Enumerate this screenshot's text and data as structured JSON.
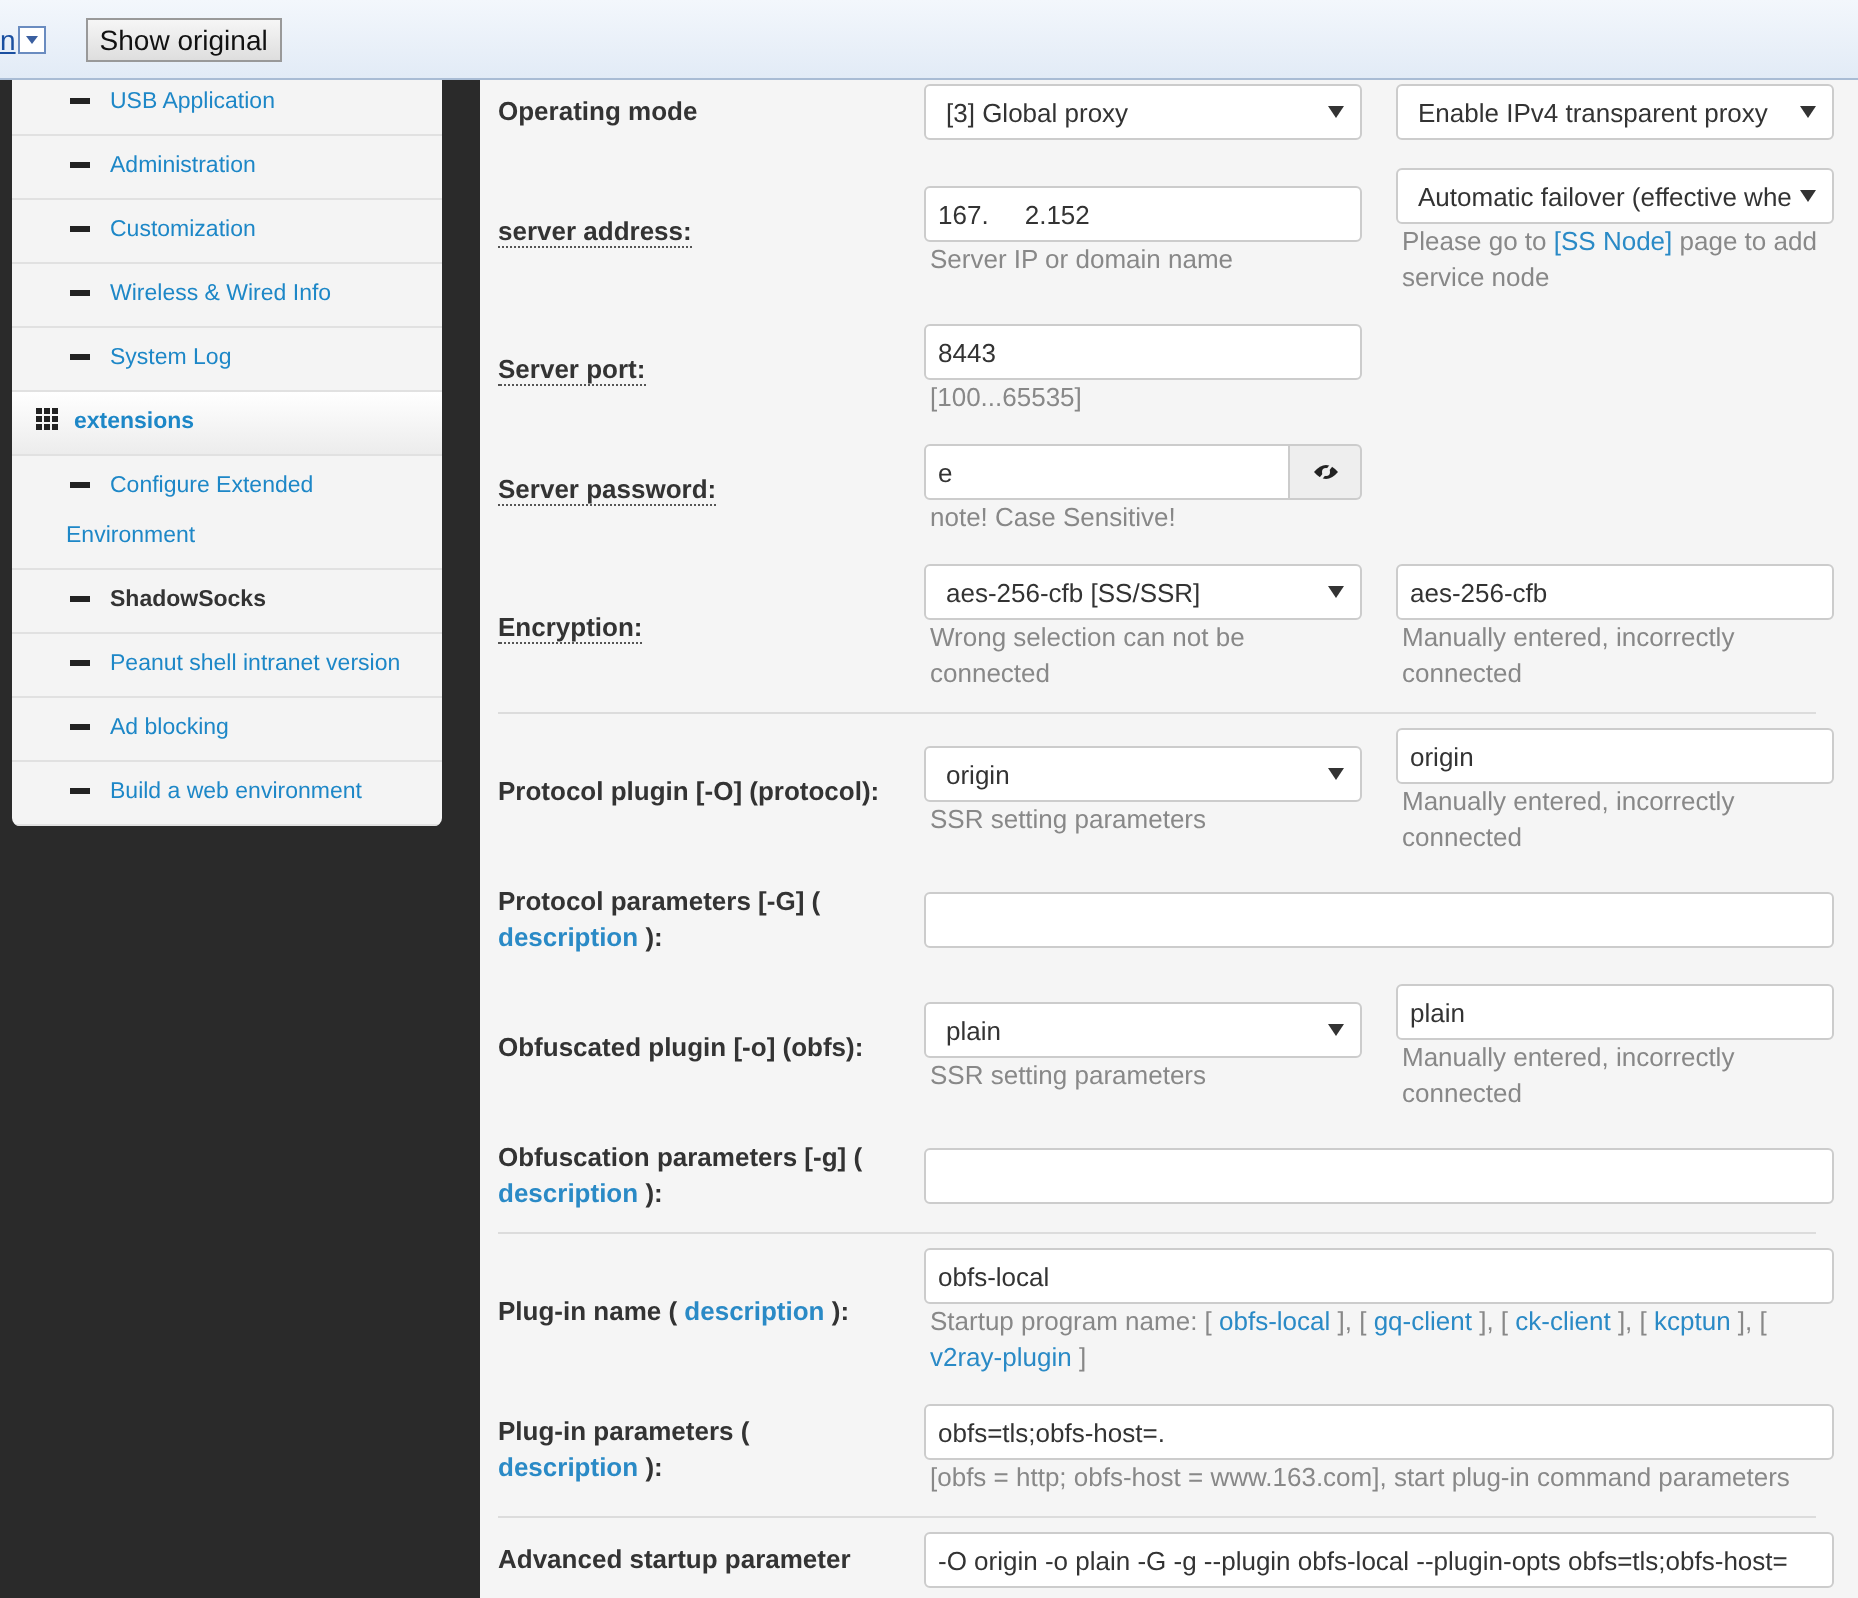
{
  "top_bar": {
    "language_fragment": "n",
    "show_original_button": "Show original"
  },
  "sidebar": {
    "items": [
      {
        "label": "USB Application",
        "kind": "sub",
        "selected": false
      },
      {
        "label": "Administration",
        "kind": "sub",
        "selected": false
      },
      {
        "label": "Customization",
        "kind": "sub",
        "selected": false
      },
      {
        "label": "Wireless & Wired Info",
        "kind": "sub",
        "selected": false
      },
      {
        "label": "System Log",
        "kind": "sub",
        "selected": false
      },
      {
        "label": "extensions",
        "kind": "group",
        "selected": false
      },
      {
        "label": "Configure Extended Environment",
        "kind": "sub",
        "selected": false
      },
      {
        "label": "ShadowSocks",
        "kind": "sub",
        "selected": true
      },
      {
        "label": "Peanut shell intranet version",
        "kind": "sub",
        "selected": false
      },
      {
        "label": "Ad blocking",
        "kind": "sub",
        "selected": false
      },
      {
        "label": "Build a web environment",
        "kind": "sub",
        "selected": false
      }
    ]
  },
  "sections": [
    {
      "rows": [
        {
          "label": [
            {
              "text": "Operating mode",
              "link": false
            }
          ],
          "underlined": false,
          "fields": [
            {
              "kind": "select",
              "value": "[3] Global proxy"
            },
            {
              "kind": "select",
              "value": "Enable IPv4 transparent proxy"
            }
          ]
        },
        {
          "label": [
            {
              "text": "server address:",
              "link": false
            }
          ],
          "underlined": true,
          "fields": [
            {
              "kind": "input",
              "value": "167.     2.152",
              "note": [
                {
                  "text": "Server IP or domain name",
                  "link": false
                }
              ]
            },
            {
              "kind": "select",
              "value": "Automatic failover (effective whe",
              "note": [
                {
                  "text": "Please go to ",
                  "link": false
                },
                {
                  "text": "[SS Node]",
                  "link": true
                },
                {
                  "text": " page to add service node",
                  "link": false
                }
              ]
            }
          ]
        },
        {
          "label": [
            {
              "text": "Server port:",
              "link": false
            }
          ],
          "underlined": true,
          "fields": [
            {
              "kind": "input",
              "value": "8443",
              "note": [
                {
                  "text": "[100...65535]",
                  "link": false
                }
              ]
            }
          ]
        },
        {
          "label": [
            {
              "text": "Server password:",
              "link": false
            }
          ],
          "underlined": true,
          "fields": [
            {
              "kind": "password",
              "value": "e",
              "note": [
                {
                  "text": "note! Case Sensitive!",
                  "link": false
                }
              ]
            }
          ]
        },
        {
          "label": [
            {
              "text": "Encryption:",
              "link": false
            }
          ],
          "underlined": true,
          "fields": [
            {
              "kind": "select",
              "value": "aes-256-cfb [SS/SSR]",
              "note": [
                {
                  "text": "Wrong selection can not be connected",
                  "link": false
                }
              ]
            },
            {
              "kind": "input",
              "value": "aes-256-cfb",
              "note": [
                {
                  "text": "Manually entered, incorrectly connected",
                  "link": false
                }
              ]
            }
          ]
        }
      ]
    },
    {
      "rows": [
        {
          "label": [
            {
              "text": "Protocol plugin [-O] (protocol):",
              "link": false
            }
          ],
          "underlined": false,
          "fields": [
            {
              "kind": "select",
              "value": "origin",
              "note": [
                {
                  "text": "SSR setting parameters",
                  "link": false
                }
              ]
            },
            {
              "kind": "input",
              "value": "origin",
              "note": [
                {
                  "text": "Manually entered, incorrectly connected",
                  "link": false
                }
              ]
            }
          ]
        },
        {
          "label": [
            {
              "text": "Protocol parameters [-G] ( ",
              "link": false
            },
            {
              "text": "description",
              "link": true
            },
            {
              "text": " ):",
              "link": false
            }
          ],
          "underlined": false,
          "fields": [
            {
              "kind": "wide_input"
            }
          ]
        },
        {
          "label": [
            {
              "text": "Obfuscated plugin [-o] (obfs):",
              "link": false
            }
          ],
          "underlined": false,
          "fields": [
            {
              "kind": "select",
              "value": "plain",
              "note": [
                {
                  "text": "SSR setting parameters",
                  "link": false
                }
              ]
            },
            {
              "kind": "input",
              "value": "plain",
              "note": [
                {
                  "text": "Manually entered, incorrectly connected",
                  "link": false
                }
              ]
            }
          ]
        },
        {
          "label": [
            {
              "text": "Obfuscation parameters [-g] ( ",
              "link": false
            },
            {
              "text": "description",
              "link": true
            },
            {
              "text": " ):",
              "link": false
            }
          ],
          "underlined": false,
          "fields": [
            {
              "kind": "wide_input"
            }
          ]
        }
      ]
    },
    {
      "rows": [
        {
          "label": [
            {
              "text": "Plug-in name ( ",
              "link": false
            },
            {
              "text": "description",
              "link": true
            },
            {
              "text": " ):",
              "link": false
            }
          ],
          "underlined": false,
          "fields": [
            {
              "kind": "wide_input",
              "value": "obfs-local",
              "note": [
                {
                  "text": "Startup program name: [ ",
                  "link": false
                },
                {
                  "text": "obfs-local",
                  "link": true
                },
                {
                  "text": " ], [ ",
                  "link": false
                },
                {
                  "text": "gq-client",
                  "link": true
                },
                {
                  "text": " ], [ ",
                  "link": false
                },
                {
                  "text": "ck-client",
                  "link": true
                },
                {
                  "text": " ], [ ",
                  "link": false
                },
                {
                  "text": "kcptun",
                  "link": true
                },
                {
                  "text": " ], [ ",
                  "link": false
                },
                {
                  "text": "v2ray-plugin",
                  "link": true
                },
                {
                  "text": " ]",
                  "link": false
                }
              ]
            }
          ]
        },
        {
          "label": [
            {
              "text": "Plug-in parameters ( ",
              "link": false
            },
            {
              "text": "description",
              "link": true
            },
            {
              "text": " ):",
              "link": false
            }
          ],
          "underlined": false,
          "fields": [
            {
              "kind": "wide_input",
              "value": "obfs=tls;obfs-host=.",
              "note": [
                {
                  "text": "[obfs = http; obfs-host = www.163.com], start plug-in command parameters",
                  "link": false
                }
              ]
            }
          ]
        }
      ]
    },
    {
      "rows": [
        {
          "label": [
            {
              "text": "Advanced startup parameter",
              "link": false
            }
          ],
          "underlined": false,
          "fields": [
            {
              "kind": "wide_input",
              "value": "-O origin -o plain -G -g --plugin obfs-local --plugin-opts obfs=tls;obfs-host="
            }
          ]
        }
      ]
    }
  ]
}
